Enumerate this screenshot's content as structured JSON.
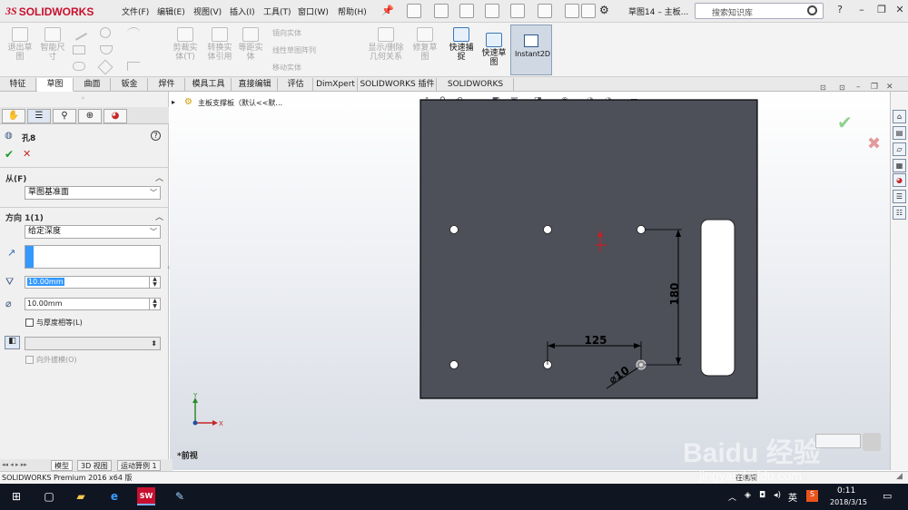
{
  "app": {
    "brand": "SOLIDWORKS",
    "brand_prefix": "3S"
  },
  "menu": [
    "文件(F)",
    "编辑(E)",
    "视图(V)",
    "插入(I)",
    "工具(T)",
    "窗口(W)",
    "帮助(H)"
  ],
  "title": "草图14 – 主板...",
  "search": {
    "placeholder": "搜索知识库"
  },
  "window_controls": [
    "?",
    "–",
    "❐",
    "✕"
  ],
  "ribbon": {
    "tools": [
      {
        "label": "退出草\n图"
      },
      {
        "label": "智能尺\n寸"
      },
      {
        "label": "剪裁实\n体(T)"
      },
      {
        "label": "转换实\n体引用"
      },
      {
        "label": "等距实\n体"
      },
      {
        "label": "显示/删除\n几何关系"
      },
      {
        "label": "修复草\n图"
      },
      {
        "label": "快速捕\n捉"
      },
      {
        "label": "快速草\n图"
      },
      {
        "label": "Instant2D"
      }
    ],
    "small_tools": [
      "镜向实体",
      "线性草图阵列",
      "移动实体"
    ]
  },
  "tabs": [
    "特征",
    "草图",
    "曲面",
    "钣金",
    "焊件",
    "模具工具",
    "直接编辑",
    "评估",
    "DimXpert",
    "SOLIDWORKS 插件",
    "SOLIDWORKS MBD"
  ],
  "feature_tree": {
    "item": "主板支撑板（默认<<默..."
  },
  "property_manager": {
    "title": "孔8",
    "from": {
      "header": "从(F)",
      "value": "草图基准面"
    },
    "direction": {
      "header": "方向 1(1)",
      "end_condition": "给定深度",
      "depth": "10.00mm",
      "diameter": "10.00mm",
      "equal_thickness": "与厚度相等(L)",
      "draft_outward": "向外拔模(O)"
    }
  },
  "drawing": {
    "dim_vertical": "180",
    "dim_horizontal": "125",
    "dim_diameter": "⌀10"
  },
  "view_label": "*前视",
  "triad": {
    "y": "Y",
    "x": "X"
  },
  "bottom_tabs": [
    "模型",
    "3D 视图",
    "运动算例 1"
  ],
  "status": {
    "left": "SOLIDWORKS Premium 2016 x64 版",
    "right": "在编辑"
  },
  "watermark": {
    "line1": "Baidu 经验",
    "line2": "jingyan.baidu.com"
  },
  "taskbar": {
    "time": "0:11",
    "date": "2018/3/15",
    "ime": "英"
  },
  "colors": {
    "plate": "#4d4f59",
    "accent": "#c8102e",
    "selection": "#3399ff"
  }
}
